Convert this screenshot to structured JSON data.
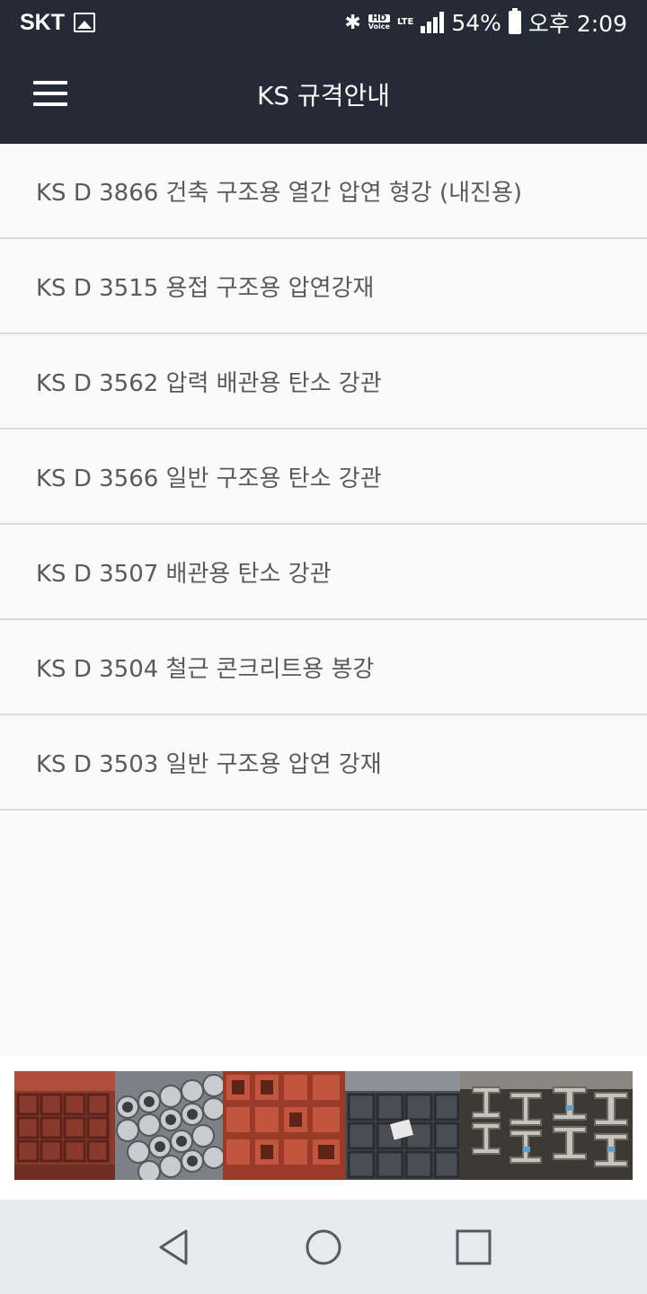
{
  "status_bar": {
    "carrier": "SKT",
    "hd_voice": "HD",
    "hd_voice_sub": "Voice",
    "network": "LTE",
    "battery": "54%",
    "time": "오후 2:09"
  },
  "app_bar": {
    "title": "KS 규격안내",
    "menu_icon": "hamburger-menu-icon"
  },
  "list": {
    "items": [
      {
        "label": "KS D 3866 건축 구조용 열간 압연 형강 (내진용)"
      },
      {
        "label": "KS D 3515 용접 구조용 압연강재"
      },
      {
        "label": "KS D 3562 압력 배관용 탄소 강관"
      },
      {
        "label": "KS D 3566 일반 구조용 탄소 강관"
      },
      {
        "label": "KS D 3507 배관용 탄소 강관"
      },
      {
        "label": "KS D 3504 철근 콘크리트용 봉강"
      },
      {
        "label": "KS D 3503 일반 구조용 압연 강재"
      }
    ]
  },
  "banner": {
    "panels": [
      "red-square-tubes",
      "galvanized-round-pipes",
      "red-channel-steel",
      "black-square-tubes",
      "h-beams"
    ]
  },
  "nav_bar": {
    "back_icon": "back-triangle-icon",
    "home_icon": "home-circle-icon",
    "recents_icon": "recents-square-icon"
  },
  "colors": {
    "app_bar": "#242b36",
    "list_text": "#5a5a5a",
    "divider": "#dcdcdc",
    "nav_bar": "#e8e9ed"
  }
}
